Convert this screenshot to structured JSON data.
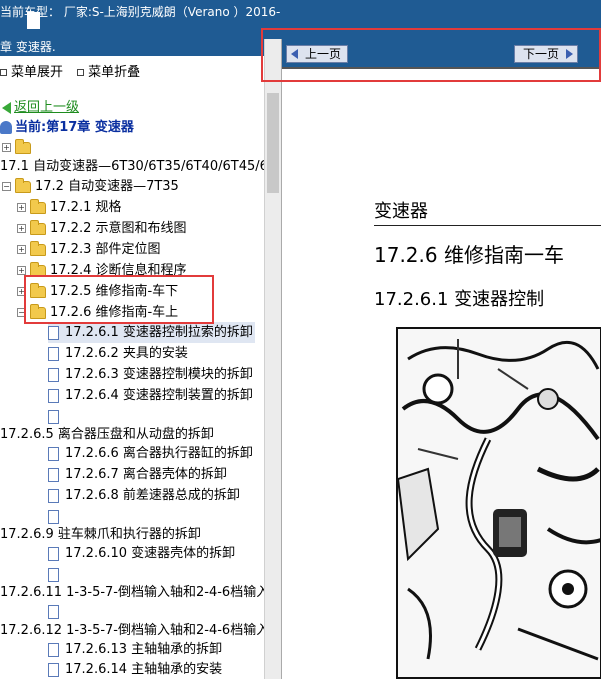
{
  "header": {
    "title": "当前车型： 厂家:S-上海别克威朗（Verano ）2016-"
  },
  "left": {
    "chapter": "章 变速器.",
    "menu_expand": "菜单展开",
    "menu_collapse": "菜单折叠",
    "back": "返回上一级",
    "current": "当前:第17章 变速器",
    "tree": [
      {
        "label": "17.1 自动变速器—6T30/6T35/6T40/6T45/6"
      },
      {
        "label": "17.2 自动变速器—7T35"
      },
      {
        "label": "17.2.1 规格"
      },
      {
        "label": "17.2.2 示意图和布线图"
      },
      {
        "label": "17.2.3 部件定位图"
      },
      {
        "label": "17.2.4 诊断信息和程序"
      },
      {
        "label": "17.2.5 维修指南-车下"
      },
      {
        "label": "17.2.6 维修指南-车上"
      },
      {
        "label": "17.2.6.1 变速器控制拉索的拆卸"
      },
      {
        "label": "17.2.6.2 夹具的安装"
      },
      {
        "label": "17.2.6.3 变速器控制模块的拆卸"
      },
      {
        "label": "17.2.6.4 变速器控制装置的拆卸"
      },
      {
        "label": "17.2.6.5 离合器压盘和从动盘的拆卸"
      },
      {
        "label": "17.2.6.6 离合器执行器缸的拆卸"
      },
      {
        "label": "17.2.6.7 离合器壳体的拆卸"
      },
      {
        "label": "17.2.6.8 前差速器总成的拆卸"
      },
      {
        "label": "17.2.6.9 驻车棘爪和执行器的拆卸"
      },
      {
        "label": "17.2.6.10 变速器壳体的拆卸"
      },
      {
        "label": "17.2.6.11 1-3-5-7-倒档输入轴和2-4-6档输入"
      },
      {
        "label": "17.2.6.12 1-3-5-7-倒档输入轴和2-4-6档输入"
      },
      {
        "label": "17.2.6.13 主轴轴承的拆卸"
      },
      {
        "label": "17.2.6.14 主轴轴承的安装"
      }
    ]
  },
  "right": {
    "prev": "上一页",
    "next": "下一页",
    "section": "变速器",
    "h2": "17.2.6 维修指南一车",
    "h3": "17.2.6.1 变速器控制"
  },
  "colors": {
    "header_bg": "#1f5b93",
    "highlight": "#e23b3b"
  }
}
